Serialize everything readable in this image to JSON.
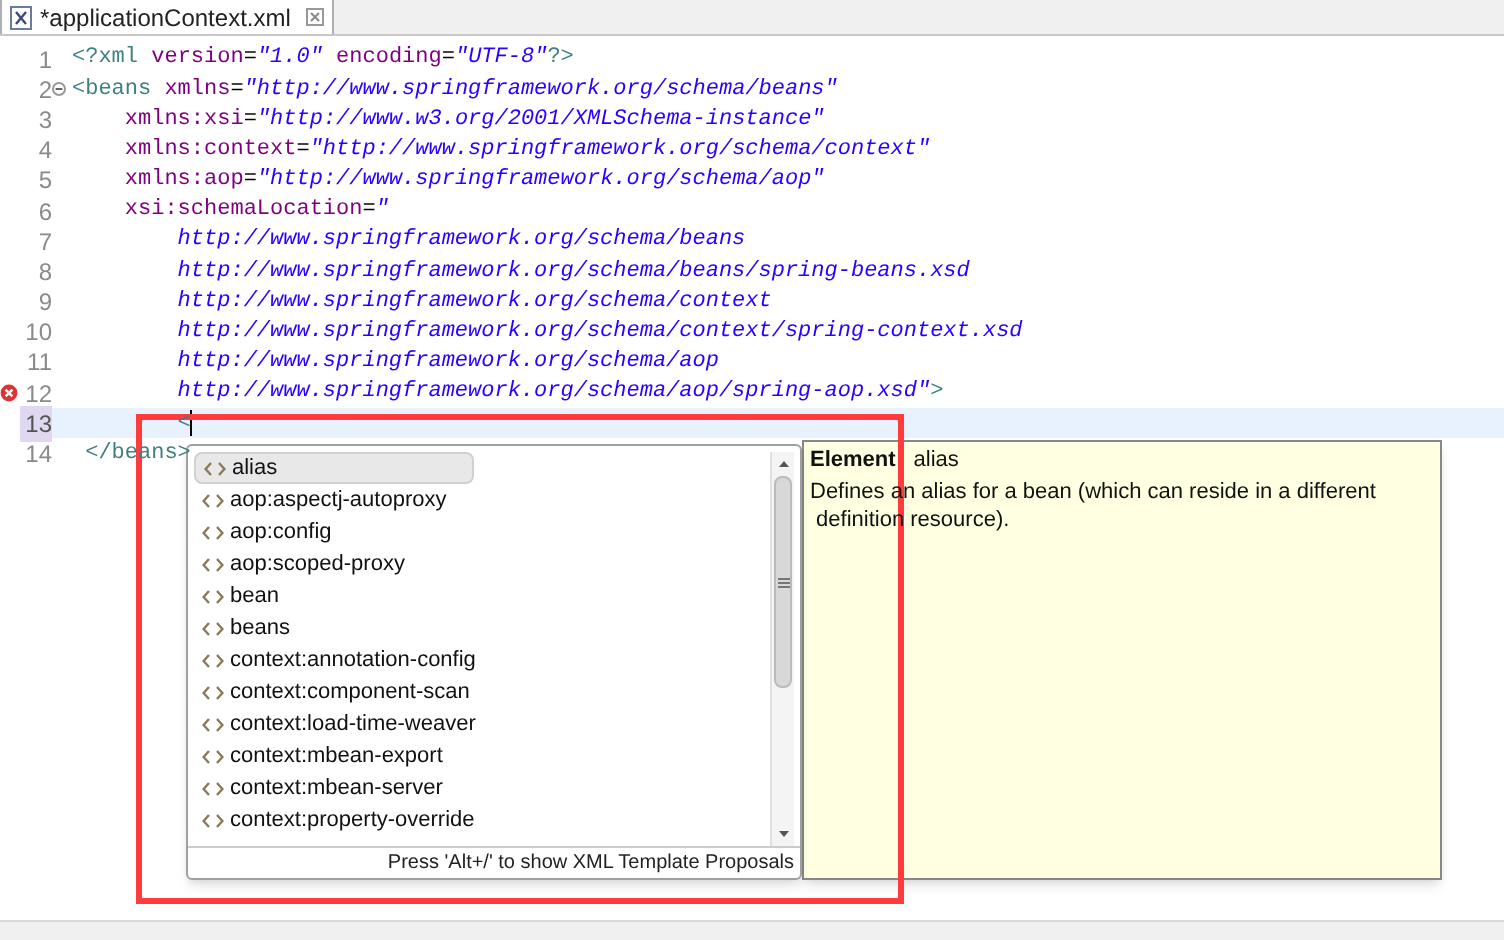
{
  "tab": {
    "title": "*applicationContext.xml",
    "selected": true
  },
  "lines": [
    {
      "number": "1",
      "current": false,
      "error": false,
      "foldable": false,
      "segments": [
        {
          "kind": "tag",
          "text": "<?xml"
        },
        {
          "kind": "attr",
          "text": " version"
        },
        {
          "kind": "plain",
          "text": "="
        },
        {
          "kind": "value",
          "text": "\"1.0\""
        },
        {
          "kind": "attr",
          "text": " encoding"
        },
        {
          "kind": "plain",
          "text": "="
        },
        {
          "kind": "value",
          "text": "\"UTF-8\""
        },
        {
          "kind": "tag",
          "text": "?>"
        }
      ]
    },
    {
      "number": "2",
      "current": false,
      "error": false,
      "foldable": true,
      "segments": [
        {
          "kind": "tag",
          "text": "<beans"
        },
        {
          "kind": "attr",
          "text": " xmlns"
        },
        {
          "kind": "plain",
          "text": "="
        },
        {
          "kind": "value",
          "text": "\"http://www.springframework.org/schema/beans\""
        }
      ]
    },
    {
      "number": "3",
      "current": false,
      "error": false,
      "foldable": false,
      "segments": [
        {
          "kind": "attr",
          "text": "    xmlns:xsi"
        },
        {
          "kind": "plain",
          "text": "="
        },
        {
          "kind": "value",
          "text": "\"http://www.w3.org/2001/XMLSchema-instance\""
        }
      ]
    },
    {
      "number": "4",
      "current": false,
      "error": false,
      "foldable": false,
      "segments": [
        {
          "kind": "attr",
          "text": "    xmlns:context"
        },
        {
          "kind": "plain",
          "text": "="
        },
        {
          "kind": "value",
          "text": "\"http://www.springframework.org/schema/context\""
        }
      ]
    },
    {
      "number": "5",
      "current": false,
      "error": false,
      "foldable": false,
      "segments": [
        {
          "kind": "attr",
          "text": "    xmlns:aop"
        },
        {
          "kind": "plain",
          "text": "="
        },
        {
          "kind": "value",
          "text": "\"http://www.springframework.org/schema/aop\""
        }
      ]
    },
    {
      "number": "6",
      "current": false,
      "error": false,
      "foldable": false,
      "segments": [
        {
          "kind": "attr",
          "text": "    xsi:schemaLocation"
        },
        {
          "kind": "plain",
          "text": "="
        },
        {
          "kind": "value",
          "text": "\""
        }
      ]
    },
    {
      "number": "7",
      "current": false,
      "error": false,
      "foldable": false,
      "segments": [
        {
          "kind": "value",
          "text": "        http://www.springframework.org/schema/beans"
        }
      ]
    },
    {
      "number": "8",
      "current": false,
      "error": false,
      "foldable": false,
      "segments": [
        {
          "kind": "value",
          "text": "        http://www.springframework.org/schema/beans/spring-beans.xsd"
        }
      ]
    },
    {
      "number": "9",
      "current": false,
      "error": false,
      "foldable": false,
      "segments": [
        {
          "kind": "value",
          "text": "        http://www.springframework.org/schema/context"
        }
      ]
    },
    {
      "number": "10",
      "current": false,
      "error": false,
      "foldable": false,
      "segments": [
        {
          "kind": "value",
          "text": "        http://www.springframework.org/schema/context/spring-context.xsd"
        }
      ]
    },
    {
      "number": "11",
      "current": false,
      "error": false,
      "foldable": false,
      "segments": [
        {
          "kind": "value",
          "text": "        http://www.springframework.org/schema/aop"
        }
      ]
    },
    {
      "number": "12",
      "current": false,
      "error": true,
      "foldable": false,
      "segments": [
        {
          "kind": "value",
          "text": "        http://www.springframework.org/schema/aop/spring-aop.xsd\""
        },
        {
          "kind": "tag",
          "text": ">"
        }
      ]
    },
    {
      "number": "13",
      "current": true,
      "error": false,
      "foldable": false,
      "segments": [
        {
          "kind": "tag",
          "text": "        <"
        }
      ]
    },
    {
      "number": "14",
      "current": false,
      "error": false,
      "foldable": false,
      "segments": [
        {
          "kind": "tag",
          "text": " </beans>"
        }
      ]
    }
  ],
  "proposals": {
    "items": [
      {
        "label": "alias",
        "selected": true
      },
      {
        "label": "aop:aspectj-autoproxy",
        "selected": false
      },
      {
        "label": "aop:config",
        "selected": false
      },
      {
        "label": "aop:scoped-proxy",
        "selected": false
      },
      {
        "label": "bean",
        "selected": false
      },
      {
        "label": "beans",
        "selected": false
      },
      {
        "label": "context:annotation-config",
        "selected": false
      },
      {
        "label": "context:component-scan",
        "selected": false
      },
      {
        "label": "context:load-time-weaver",
        "selected": false
      },
      {
        "label": "context:mbean-export",
        "selected": false
      },
      {
        "label": "context:mbean-server",
        "selected": false
      },
      {
        "label": "context:property-override",
        "selected": false
      }
    ],
    "status": "Press 'Alt+/' to show XML Template Proposals"
  },
  "info": {
    "label": "Element",
    "name": "alias",
    "description_lines": [
      "Defines an alias for a bean (which can reside in a different",
      " definition resource)."
    ]
  }
}
